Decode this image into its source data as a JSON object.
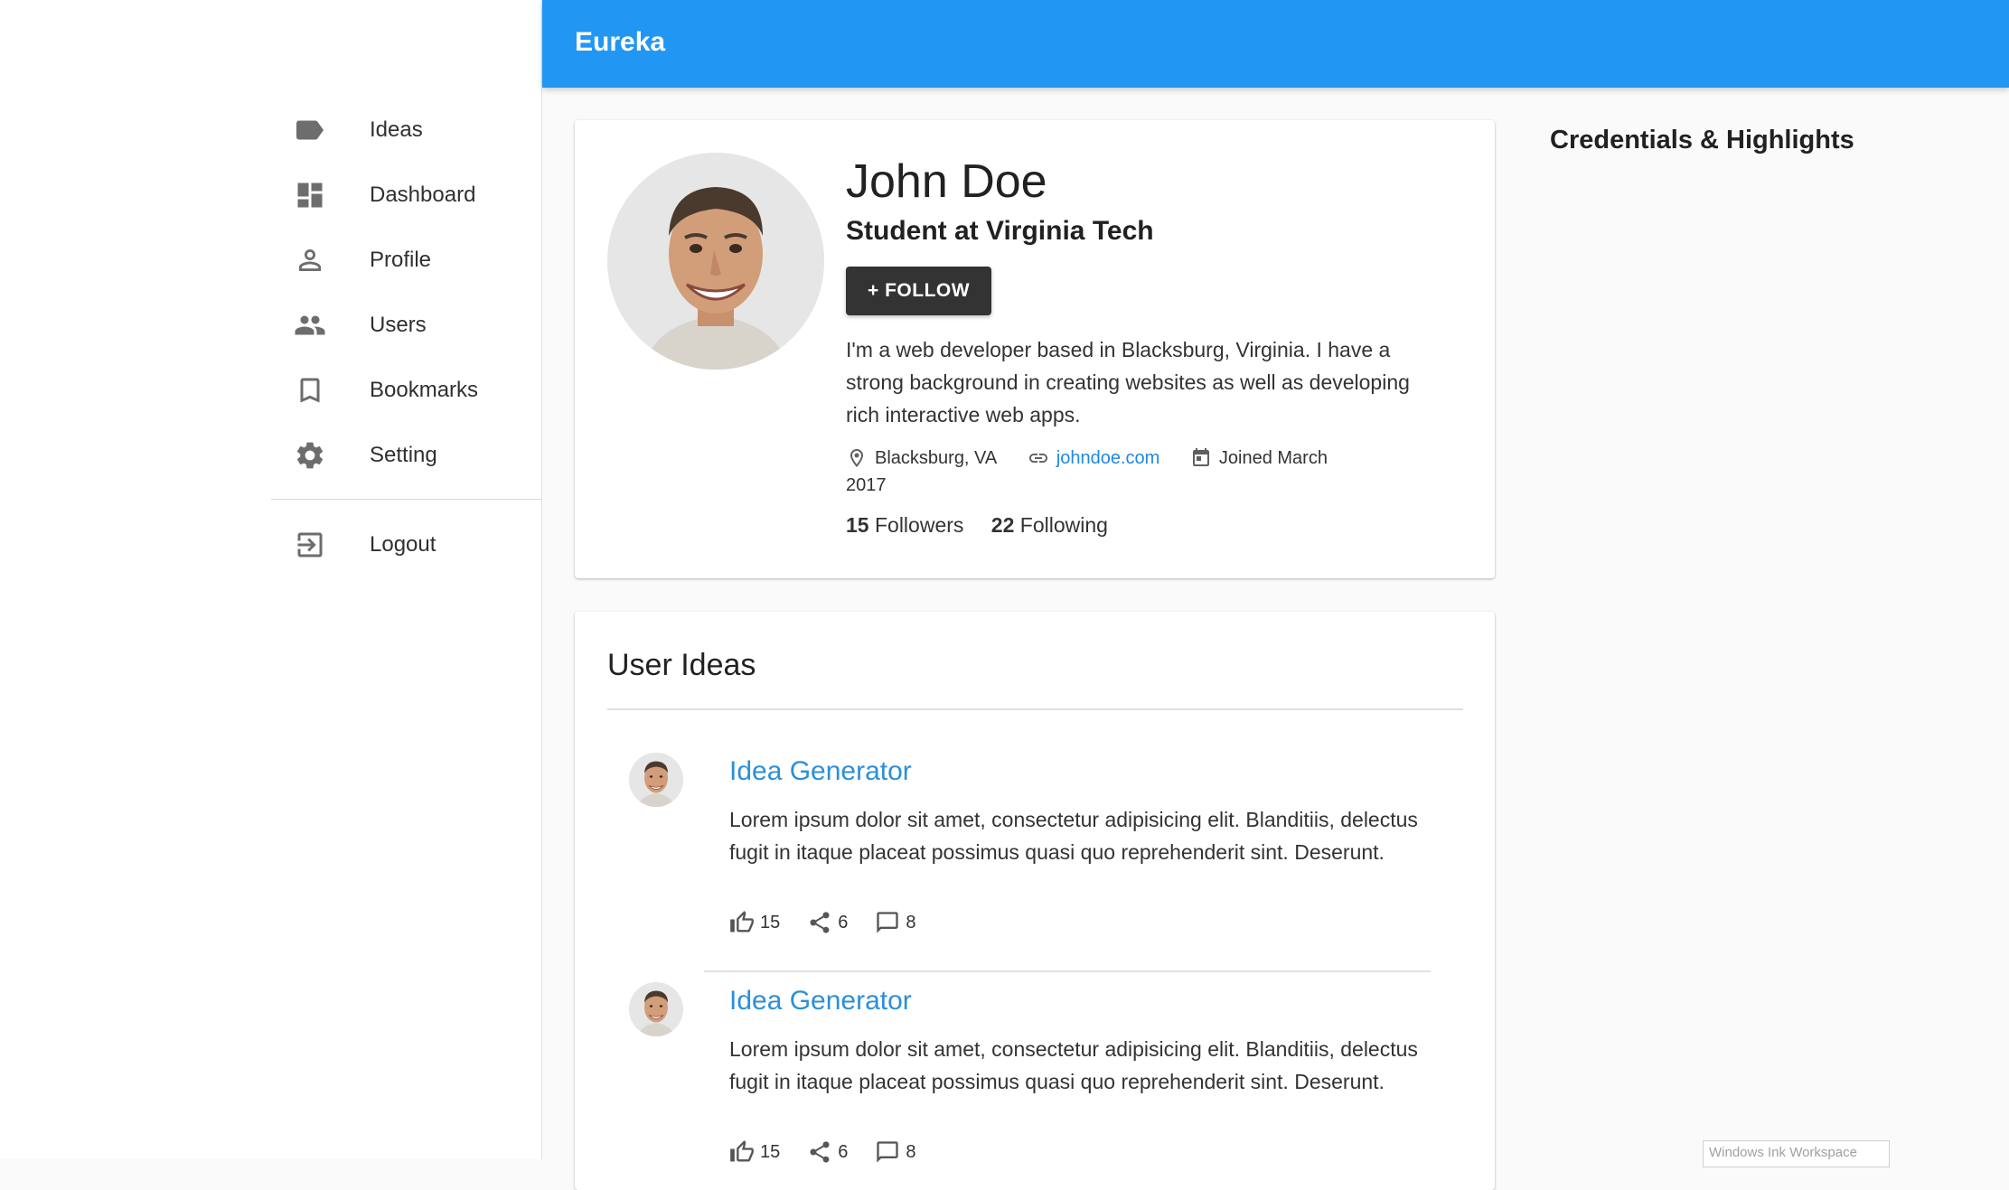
{
  "app": {
    "title": "Eureka"
  },
  "sidebar": {
    "items": [
      {
        "label": "Ideas",
        "icon": "label-icon"
      },
      {
        "label": "Dashboard",
        "icon": "dashboard-icon"
      },
      {
        "label": "Profile",
        "icon": "person-icon"
      },
      {
        "label": "Users",
        "icon": "people-icon"
      },
      {
        "label": "Bookmarks",
        "icon": "bookmark-icon"
      },
      {
        "label": "Setting",
        "icon": "gear-icon"
      }
    ],
    "logout": {
      "label": "Logout",
      "icon": "logout-icon"
    }
  },
  "profile": {
    "name": "John Doe",
    "headline": "Student at Virginia Tech",
    "follow_label": "+ FOLLOW",
    "bio": "I'm a web developer based in Blacksburg, Virginia. I have a strong background in creating websites as well as developing rich interactive web apps.",
    "location": "Blacksburg, VA",
    "website": "johndoe.com",
    "joined_line1": "Joined March",
    "joined_line2": "2017",
    "followers_count": "15",
    "followers_label": "Followers",
    "following_count": "22",
    "following_label": "Following"
  },
  "ideas": {
    "title": "User Ideas",
    "items": [
      {
        "title": "Idea Generator",
        "text": "Lorem ipsum dolor sit amet, consectetur adipisicing elit. Blanditiis, delectus fugit in itaque placeat possimus quasi quo reprehenderit sint. Deserunt.",
        "likes": "15",
        "shares": "6",
        "comments": "8"
      },
      {
        "title": "Idea Generator",
        "text": "Lorem ipsum dolor sit amet, consectetur adipisicing elit. Blanditiis, delectus fugit in itaque placeat possimus quasi quo reprehenderit sint. Deserunt.",
        "likes": "15",
        "shares": "6",
        "comments": "8"
      }
    ]
  },
  "credentials": {
    "title": "Credentials & Highlights"
  },
  "overlay": {
    "ink_workspace": "Windows Ink Workspace"
  },
  "colors": {
    "appbar": "#2196f3",
    "link": "#2b8fd9",
    "button": "#333333"
  }
}
